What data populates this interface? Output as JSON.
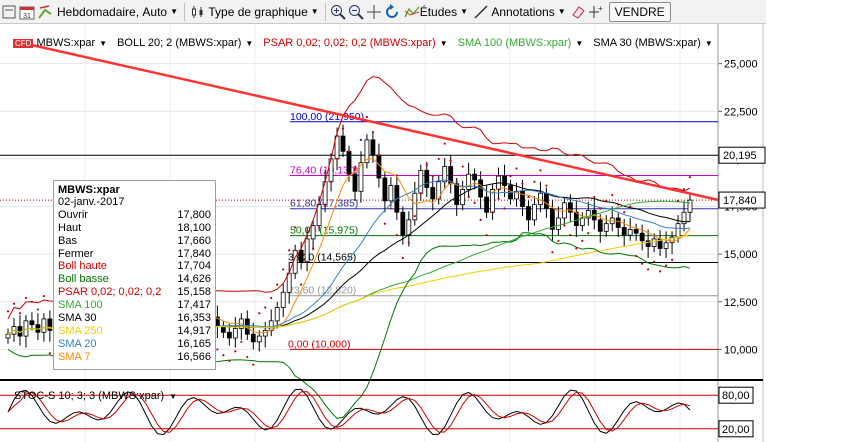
{
  "toolbar": {
    "timeframe": "Hebdomadaire,",
    "scale": "Auto",
    "chart_type": "Type de graphique",
    "studies": "Études",
    "annotations": "Annotations",
    "sell_button": "VENDRE"
  },
  "legend": {
    "symbol": "MBWS:xpar",
    "boll": "BOLL 20; 2 (MBWS:xpar)",
    "psar": "PSAR 0,02; 0,02; 0,2 (MBWS:xpar)",
    "sma100": "SMA 100 (MBWS:xpar)",
    "sma30": "SMA 30 (MBWS:xpar)",
    "colors": {
      "boll": "#000000",
      "psar": "#cc0000",
      "sma100": "#33aa33",
      "sma30": "#000000"
    }
  },
  "infobox": {
    "title": "MBWS:xpar",
    "date": "02-janv.-2017",
    "rows": [
      {
        "label": "Ouvrir",
        "value": "17,800",
        "color": "#000000"
      },
      {
        "label": "Haut",
        "value": "18,100",
        "color": "#000000"
      },
      {
        "label": "Bas",
        "value": "17,660",
        "color": "#000000"
      },
      {
        "label": "Fermer",
        "value": "17,840",
        "color": "#000000"
      },
      {
        "label": "Boll haute",
        "value": "17,704",
        "color": "#cc0000"
      },
      {
        "label": "Boll basse",
        "value": "14,626",
        "color": "#007700"
      },
      {
        "label": "PSAR 0,02; 0,02; 0,2",
        "value": "15,158",
        "color": "#cc0000"
      },
      {
        "label": "SMA 100",
        "value": "17,417",
        "color": "#33aa33"
      },
      {
        "label": "SMA 30",
        "value": "16,353",
        "color": "#000000"
      },
      {
        "label": "SMA 250",
        "value": "14,917",
        "color": "#f0d000"
      },
      {
        "label": "SMA 20",
        "value": "16,165",
        "color": "#3380cc"
      },
      {
        "label": "SMA 7",
        "value": "16,566",
        "color": "#ff8800"
      }
    ]
  },
  "axis": {
    "ticks": [
      {
        "value": 25,
        "label": "25,000"
      },
      {
        "value": 22.5,
        "label": "22,500"
      },
      {
        "value": 20,
        "label": "20,000"
      },
      {
        "value": 17.5,
        "label": "17,500"
      },
      {
        "value": 15,
        "label": "15,000"
      },
      {
        "value": 12.5,
        "label": "12,500"
      },
      {
        "value": 10,
        "label": "10,000"
      }
    ],
    "badges": [
      {
        "value": 20.195,
        "label": "20,195"
      },
      {
        "value": 17.84,
        "label": "17,840"
      }
    ]
  },
  "fibonacci": [
    {
      "value": 21.95,
      "label": "100,00 (21,950)",
      "color": "#0000cc"
    },
    {
      "value": 19.13,
      "label": "76,40 (19,130)",
      "color": "#cc00cc"
    },
    {
      "value": 17.385,
      "label": "61,80 (17,385)",
      "color": "#3333aa"
    },
    {
      "value": 15.975,
      "label": "50,00 (15,975)",
      "color": "#007700"
    },
    {
      "value": 14.565,
      "label": "38,20 (14,565)",
      "color": "#000000"
    },
    {
      "value": 12.82,
      "label": "23,60 (12,820)",
      "color": "#999999"
    },
    {
      "value": 10.0,
      "label": "0,00 (10,000)",
      "color": "#cc0000"
    }
  ],
  "stochastic": {
    "title": "STOC-S 10; 3; 3 (MBWS:xpar)",
    "upper_label": "80,00",
    "lower_label": "20,00",
    "upper": 80,
    "lower": 20
  },
  "chart_data": {
    "type": "candlestick",
    "ylim": [
      8.5,
      26.4
    ],
    "closes": [
      10.8,
      11.2,
      10.7,
      11.5,
      11.3,
      10.9,
      11.6,
      11.0,
      10.6,
      11.4,
      11.9,
      11.3,
      10.8,
      11.2,
      11.7,
      11.1,
      10.6,
      10.4,
      11.0,
      11.5,
      10.9,
      10.5,
      11.3,
      11.8,
      11.2,
      10.8,
      10.4,
      10.9,
      11.6,
      12.0,
      11.4,
      11.1,
      11.8,
      12.3,
      11.7,
      11.2,
      10.9,
      10.6,
      11.1,
      11.6,
      10.8,
      10.4,
      10.7,
      11.0,
      11.5,
      12.2,
      13.0,
      14.0,
      15.2,
      14.6,
      15.8,
      16.5,
      17.6,
      18.8,
      20.0,
      21.2,
      20.4,
      19.2,
      18.3,
      19.8,
      21.0,
      20.2,
      19.0,
      17.8,
      18.6,
      17.2,
      16.0,
      16.8,
      18.2,
      19.4,
      18.5,
      17.9,
      18.8,
      19.6,
      18.7,
      17.6,
      18.4,
      19.2,
      18.9,
      18.0,
      17.2,
      18.4,
      19.1,
      18.6,
      17.9,
      18.3,
      17.5,
      16.8,
      17.6,
      18.2,
      17.4,
      16.3,
      16.9,
      17.7,
      17.2,
      16.5,
      16.9,
      17.3,
      16.8,
      16.2,
      16.6,
      16.9,
      16.4,
      16.0,
      16.3,
      16.1,
      15.7,
      15.4,
      15.8,
      15.3,
      15.6,
      15.9,
      16.6,
      17.2,
      17.84
    ]
  }
}
